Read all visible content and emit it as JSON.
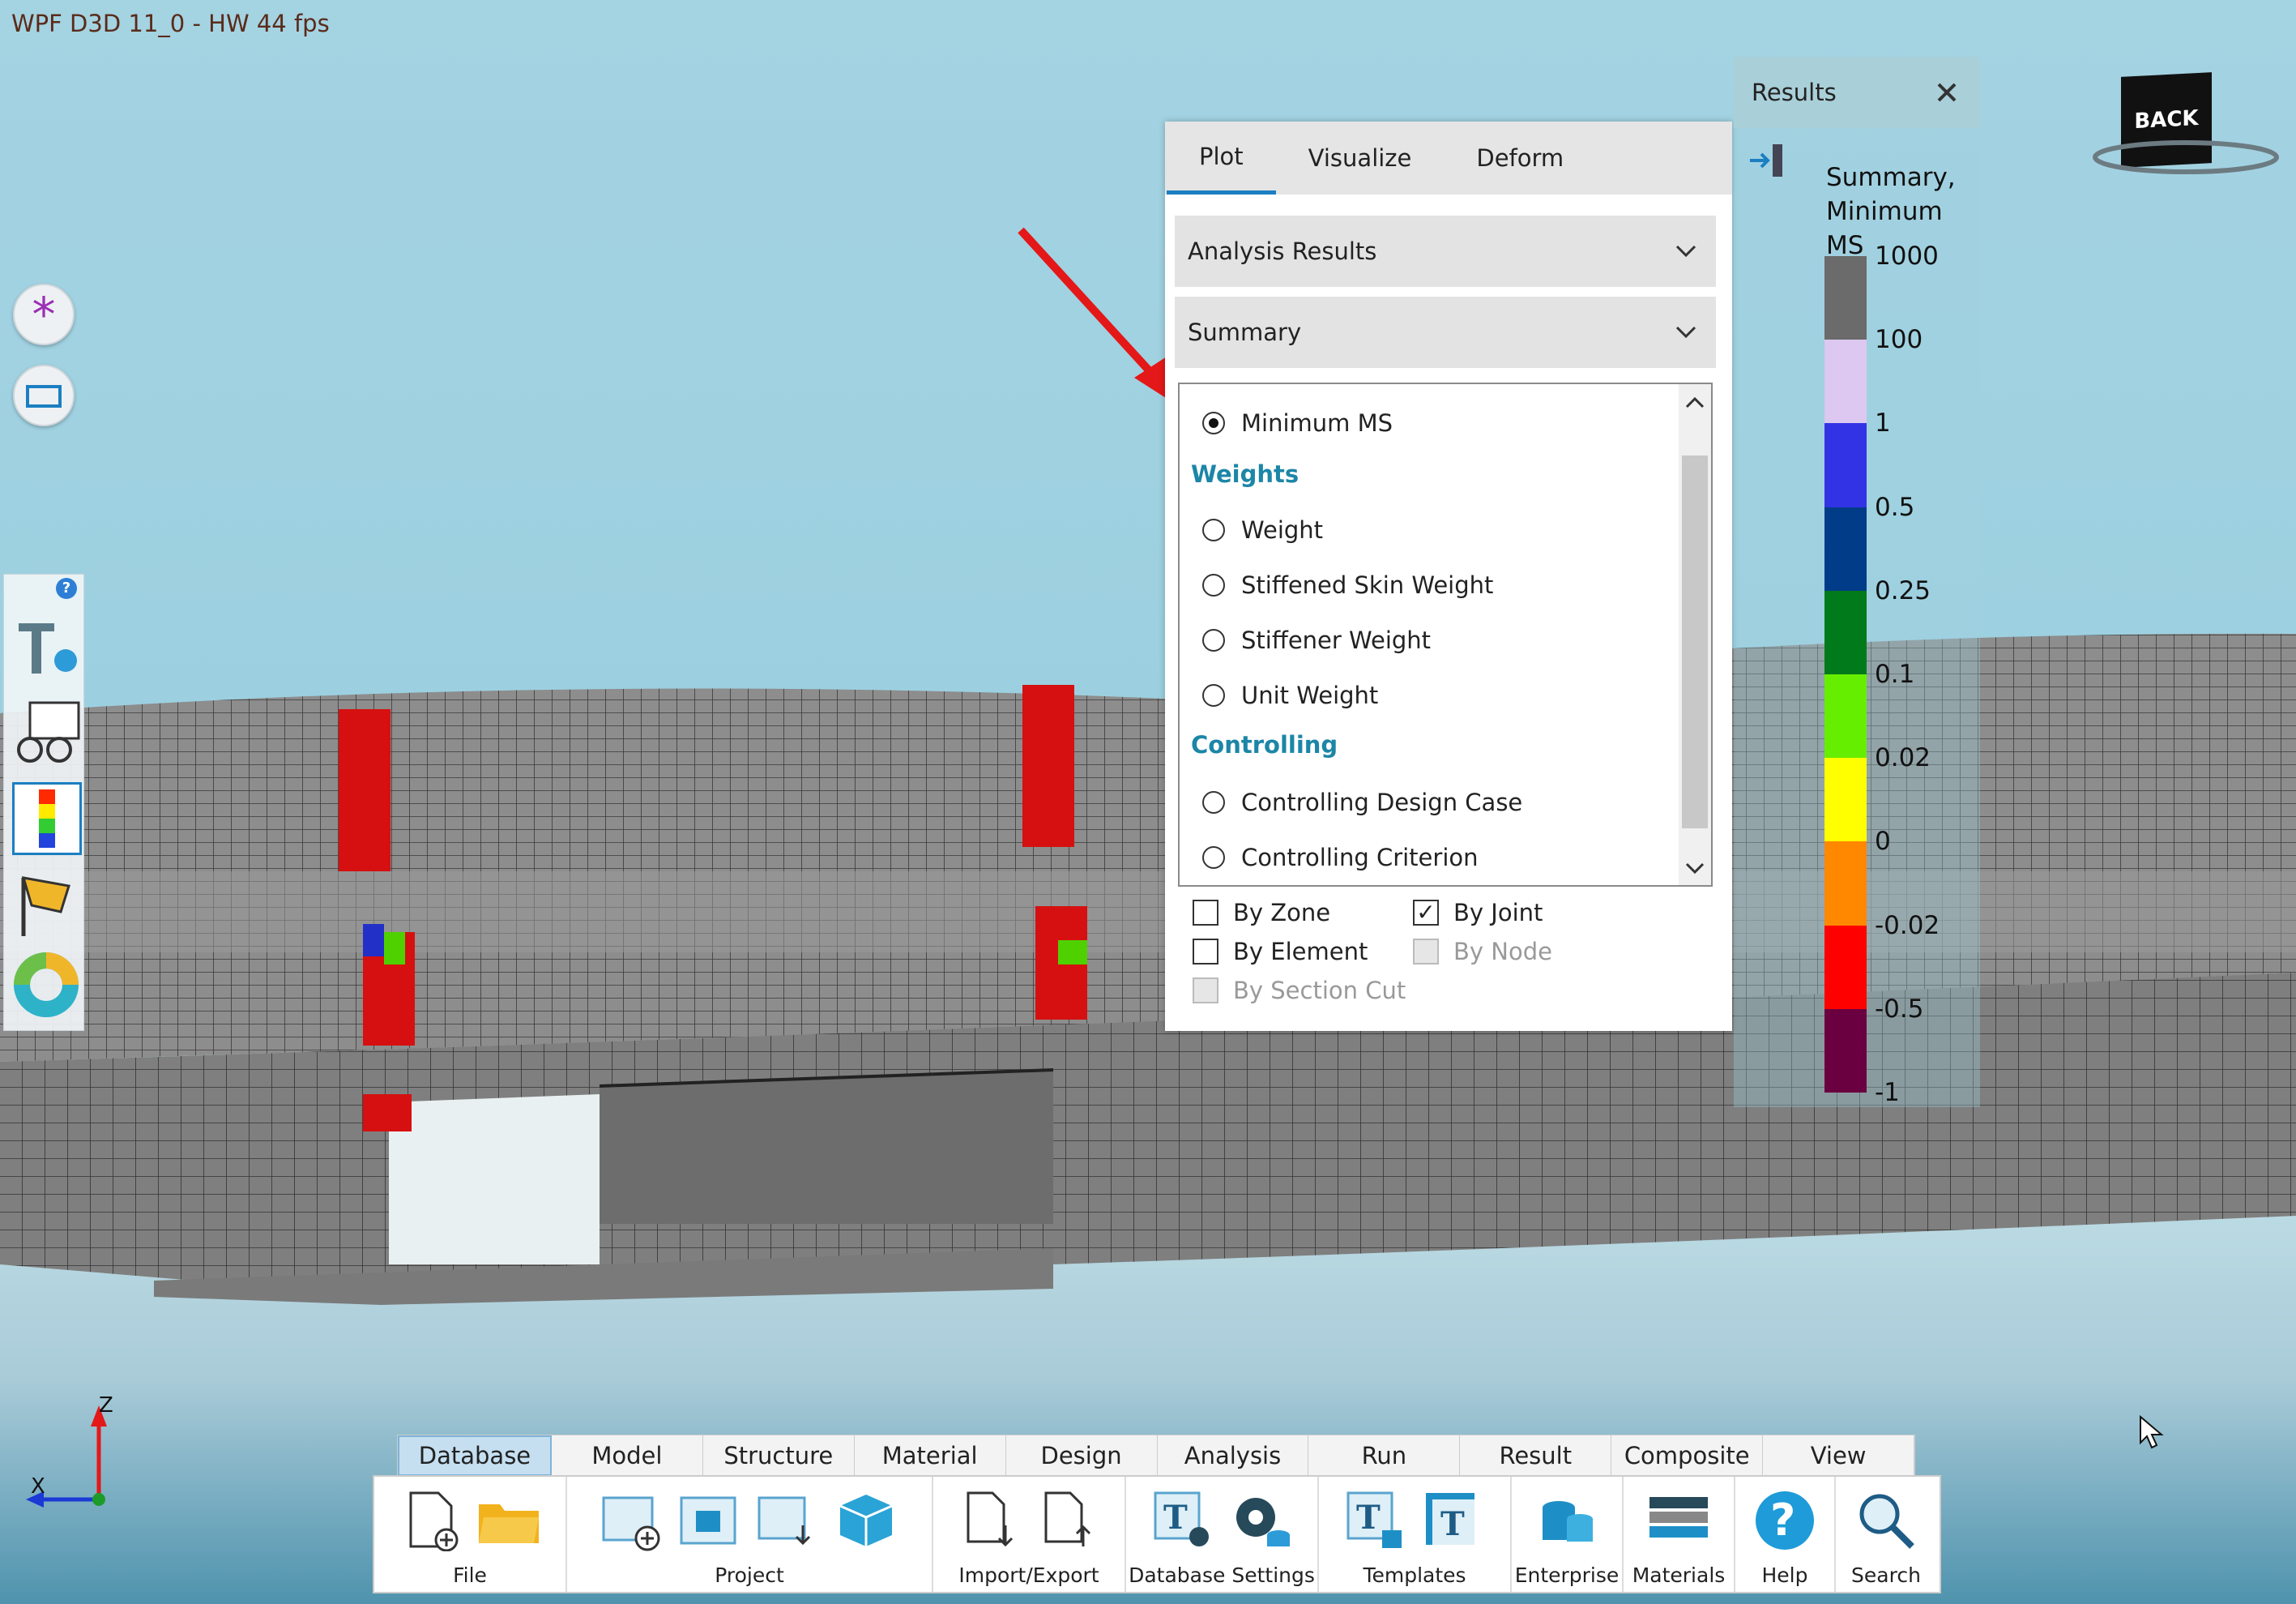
{
  "window": {
    "title": "WPF D3D 11_0 - HW  44 fps"
  },
  "panel": {
    "tabs": [
      "Plot",
      "Visualize",
      "Deform"
    ],
    "active_tab": "Plot",
    "dropdown_results": "Analysis Results",
    "dropdown_summary": "Summary",
    "options": {
      "minimum_ms": "Minimum MS",
      "group_weights": "Weights",
      "weight": "Weight",
      "stiffened_skin_weight": "Stiffened Skin Weight",
      "stiffener_weight": "Stiffener Weight",
      "unit_weight": "Unit Weight",
      "group_controlling": "Controlling",
      "controlling_design_case": "Controlling Design Case",
      "controlling_criterion": "Controlling Criterion"
    },
    "selected_option": "Minimum MS",
    "checks": {
      "by_zone": {
        "label": "By Zone",
        "checked": false,
        "enabled": true
      },
      "by_joint": {
        "label": "By Joint",
        "checked": true,
        "enabled": true
      },
      "by_element": {
        "label": "By Element",
        "checked": false,
        "enabled": true
      },
      "by_node": {
        "label": "By Node",
        "checked": false,
        "enabled": false
      },
      "by_section_cut": {
        "label": "By Section Cut",
        "checked": false,
        "enabled": false
      }
    }
  },
  "results": {
    "header": "Results",
    "legend_title_1": "Summary,",
    "legend_title_2": "Minimum MS",
    "levels": [
      "1000",
      "100",
      "1",
      "0.5",
      "0.25",
      "0.1",
      "0.02",
      "0",
      "-0.02",
      "-0.5",
      "-1"
    ],
    "colors": [
      "#6b6b6b",
      "#dcc8f0",
      "#3333e6",
      "#003c88",
      "#007a1a",
      "#66ee00",
      "#ffff00",
      "#ff8800",
      "#ff0000",
      "#6a0040"
    ]
  },
  "back_button": "BACK",
  "axes": {
    "z": "Z",
    "x": "X"
  },
  "ribbon": {
    "tabs": [
      "Database",
      "Model",
      "Structure",
      "Material",
      "Design",
      "Analysis",
      "Run",
      "Result",
      "Composite",
      "View"
    ],
    "active_tab": "Database",
    "groups": {
      "file": "File",
      "project": "Project",
      "import_export": "Import/Export",
      "database_settings": "Database Settings",
      "templates": "Templates",
      "enterprise": "Enterprise",
      "materials": "Materials",
      "help": "Help",
      "search": "Search"
    }
  }
}
